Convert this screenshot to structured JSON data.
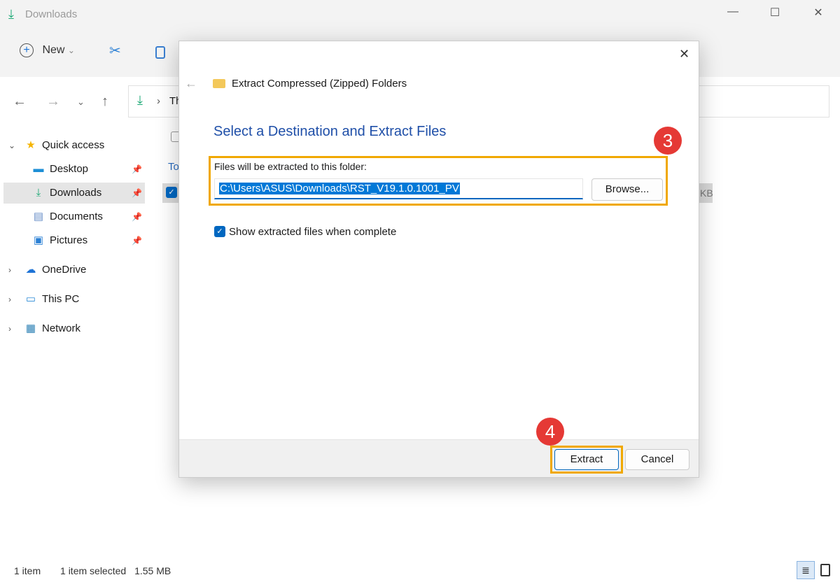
{
  "window": {
    "title": "Downloads",
    "minimize": "—",
    "maximize": "☐",
    "close": "✕"
  },
  "toolbar": {
    "new_label": "New",
    "new_chevron": "⌄"
  },
  "address": {
    "partial": "Th",
    "separator": "›"
  },
  "sidebar": {
    "items": [
      {
        "label": "Quick access",
        "icon": "star-icon",
        "glyph": "★",
        "color": "#f5b400",
        "pinned": false,
        "top": true,
        "chev": "⌄"
      },
      {
        "label": "Desktop",
        "icon": "desktop-icon",
        "glyph": "▬",
        "color": "#1e8fd6",
        "pinned": true
      },
      {
        "label": "Downloads",
        "icon": "download-icon",
        "glyph": "⤓",
        "color": "#1aa874",
        "pinned": true,
        "selected": true
      },
      {
        "label": "Documents",
        "icon": "documents-icon",
        "glyph": "▤",
        "color": "#6a8fc8",
        "pinned": true
      },
      {
        "label": "Pictures",
        "icon": "pictures-icon",
        "glyph": "▣",
        "color": "#2a7fd4",
        "pinned": true
      },
      {
        "label": "OneDrive",
        "icon": "cloud-icon",
        "glyph": "☁",
        "color": "#1e73d6",
        "top": true,
        "chev": "›"
      },
      {
        "label": "This PC",
        "icon": "computer-icon",
        "glyph": "▭",
        "color": "#2a8ad6",
        "top": true,
        "chev": "›"
      },
      {
        "label": "Network",
        "icon": "network-icon",
        "glyph": "▦",
        "color": "#2a7fb4",
        "top": true,
        "chev": "›"
      }
    ]
  },
  "content": {
    "group_partial": "To",
    "size_partial": "KB"
  },
  "dialog": {
    "header": "Extract Compressed (Zipped) Folders",
    "heading": "Select a Destination and Extract Files",
    "folder_label": "Files will be extracted to this folder:",
    "path_value": "C:\\Users\\ASUS\\Downloads\\RST_V19.1.0.1001_PV",
    "browse_label": "Browse...",
    "checkbox_label": "Show extracted files when complete",
    "checkbox_checked": true,
    "extract_label": "Extract",
    "cancel_label": "Cancel",
    "close": "✕"
  },
  "annotations": {
    "step3": "3",
    "step4": "4",
    "highlight_color": "#f0a800",
    "badge_color": "#e53935"
  },
  "status": {
    "count": "1 item",
    "selected": "1 item selected",
    "size": "1.55 MB"
  },
  "colors": {
    "accent": "#0067c0",
    "heading": "#1f4fa8"
  }
}
